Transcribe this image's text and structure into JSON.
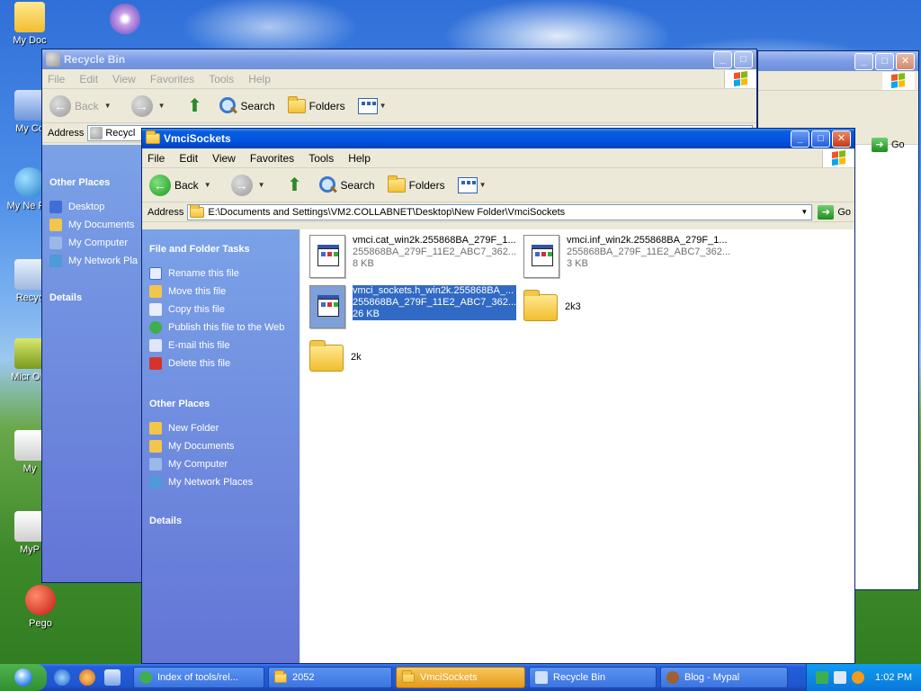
{
  "desktop": {
    "icons": [
      {
        "label": "My Doc"
      },
      {
        "label": "My Co"
      },
      {
        "label": "My Ne Pla"
      },
      {
        "label": "Recyc"
      },
      {
        "label": "Micr Out"
      },
      {
        "label": "My"
      },
      {
        "label": "MyP"
      },
      {
        "label": "Pego"
      }
    ]
  },
  "recycle_window": {
    "title": "Recycle Bin",
    "menu": [
      "File",
      "Edit",
      "View",
      "Favorites",
      "Tools",
      "Help"
    ],
    "back_label": "Back",
    "search_label": "Search",
    "folders_label": "Folders",
    "address_label": "Address",
    "address_value": "Recycl",
    "other_places_head": "Other Places",
    "places": [
      "Desktop",
      "My Documents",
      "My Computer",
      "My Network Pla"
    ],
    "details_head": "Details"
  },
  "back_window": {
    "go_label": "Go"
  },
  "main_window": {
    "title": "VmciSockets",
    "menu": [
      "File",
      "Edit",
      "View",
      "Favorites",
      "Tools",
      "Help"
    ],
    "back_label": "Back",
    "search_label": "Search",
    "folders_label": "Folders",
    "address_label": "Address",
    "address_value": "E:\\Documents and Settings\\VM2.COLLABNET\\Desktop\\New Folder\\VmciSockets",
    "go_label": "Go",
    "tasks_head": "File and Folder Tasks",
    "tasks": [
      "Rename this file",
      "Move this file",
      "Copy this file",
      "Publish this file to the Web",
      "E-mail this file",
      "Delete this file"
    ],
    "other_places_head": "Other Places",
    "places": [
      "New Folder",
      "My Documents",
      "My Computer",
      "My Network Places"
    ],
    "details_head": "Details",
    "files": [
      {
        "name": "vmci.cat_win2k.255868BA_279F_1...",
        "line2": "255868BA_279F_11E2_ABC7_362...",
        "size": "8 KB"
      },
      {
        "name": "vmci.inf_win2k.255868BA_279F_1...",
        "line2": "255868BA_279F_11E2_ABC7_362...",
        "size": "3 KB"
      },
      {
        "name": "vmci_sockets.h_win2k.255868BA_...",
        "line2": "255868BA_279F_11E2_ABC7_362...",
        "size": "26 KB"
      }
    ],
    "folders": [
      "2k3",
      "2k"
    ]
  },
  "taskbar": {
    "tasks": [
      "Index of tools/rel...",
      "2052",
      "VmciSockets",
      "Recycle Bin",
      "Blog - Mypal"
    ],
    "clock": "1:02 PM"
  }
}
